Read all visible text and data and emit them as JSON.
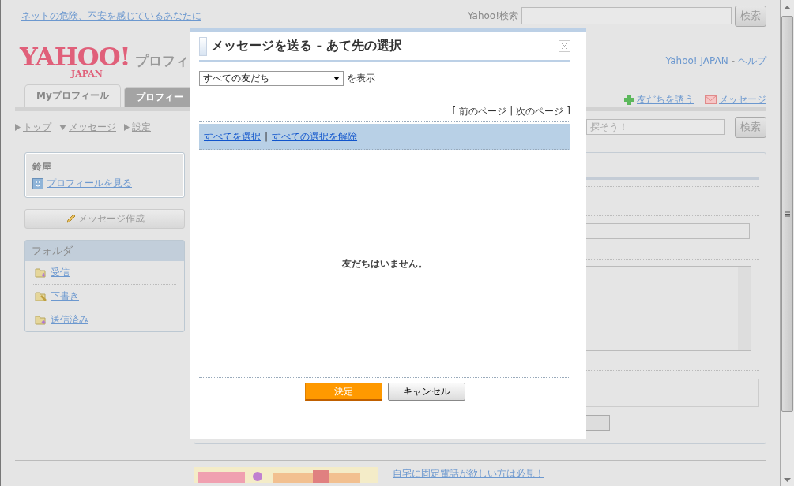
{
  "top_bar": {
    "notice_link": "ネットの危険、不安を感じているあなたに",
    "search_label": "Yahoo!検索",
    "search_button": "検索"
  },
  "header": {
    "logo": "YAHOO!",
    "logo_sub": "JAPAN",
    "service_title": "プロフィ",
    "links": [
      "Yahoo! JAPAN",
      "ヘルプ"
    ],
    "link_separator": "-"
  },
  "tabs": [
    {
      "label": "Myプロフィール",
      "selected": true
    },
    {
      "label": "プロフィー",
      "selected": false
    }
  ],
  "actions": [
    {
      "label": "友だちを誘う",
      "kind": "invite"
    },
    {
      "label": "メッセージ",
      "kind": "message"
    }
  ],
  "breadcrumb": [
    {
      "label": "トップ",
      "expanded": false
    },
    {
      "label": "メッセージ",
      "expanded": true
    },
    {
      "label": "設定",
      "expanded": false
    }
  ],
  "site_search": {
    "placeholder": "探そう！",
    "button": "検索"
  },
  "sidebar": {
    "user_name": "鈴屋",
    "profile_link": "プロフィールを見る",
    "compose_button": "メッセージ作成",
    "folders_title": "フォルダ",
    "folders": [
      {
        "label": "受信",
        "kind": "inbox"
      },
      {
        "label": "下書き",
        "kind": "draft"
      },
      {
        "label": "送信済み",
        "kind": "sent"
      }
    ]
  },
  "footer": {
    "promo_link": "自宅に固定電話が欲しい方は必見！"
  },
  "dialog": {
    "title": "メッセージを送る - あて先の選択",
    "filter": {
      "value": "すべての友だち",
      "suffix": "を表示"
    },
    "pager": {
      "open": "[",
      "prev": "前のページ",
      "separator": "|",
      "next": "次のページ",
      "close": "]"
    },
    "select_all": "すべてを選択",
    "separator": "|",
    "deselect_all": "すべての選択を解除",
    "empty_message": "友だちはいません。",
    "buttons": [
      {
        "label": "決定",
        "kind": "primary"
      },
      {
        "label": "キャンセル",
        "kind": "secondary"
      }
    ]
  }
}
